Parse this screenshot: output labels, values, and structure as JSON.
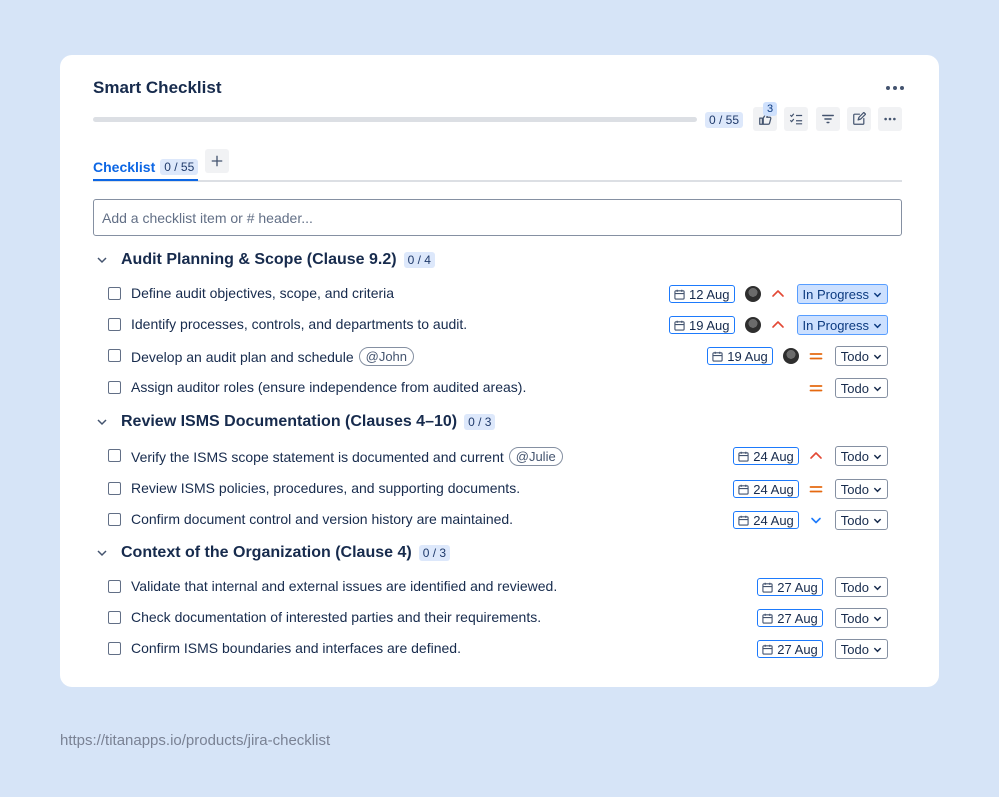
{
  "app": {
    "title": "Smart Checklist"
  },
  "progress": {
    "label": "0 / 55",
    "fraction": 0
  },
  "toolbar": {
    "likes_count": "3"
  },
  "tabs": [
    {
      "label": "Checklist",
      "count": "0 / 55"
    }
  ],
  "add_input": {
    "placeholder": "Add a checklist item or # header..."
  },
  "colors": {
    "accent": "#0c66e4",
    "priority_high": "#e34935",
    "priority_medium": "#e56910",
    "priority_low": "#1d7afc",
    "in_progress": "#cce0ff"
  },
  "sections": [
    {
      "title": "Audit Planning & Scope (Clause 9.2)",
      "count": "0 / 4",
      "items": [
        {
          "text": "Define audit objectives, scope, and criteria",
          "mention": "",
          "date": "12 Aug",
          "avatar": true,
          "priority": "high",
          "status": "In Progress"
        },
        {
          "text": "Identify processes, controls, and departments to audit.",
          "mention": "",
          "date": "19 Aug",
          "avatar": true,
          "priority": "high",
          "status": "In Progress"
        },
        {
          "text": "Develop an audit plan and schedule",
          "mention": "@John",
          "date": "19 Aug",
          "avatar": true,
          "priority": "medium",
          "status": "Todo"
        },
        {
          "text": "Assign auditor roles (ensure independence from audited areas).",
          "mention": "",
          "date": "",
          "avatar": false,
          "priority": "medium",
          "status": "Todo"
        }
      ]
    },
    {
      "title": "Review ISMS Documentation (Clauses 4–10)",
      "count": "0 / 3",
      "items": [
        {
          "text": "Verify the ISMS scope statement is documented and current",
          "mention": "@Julie",
          "date": "24 Aug",
          "avatar": false,
          "priority": "high",
          "status": "Todo"
        },
        {
          "text": "Review ISMS policies, procedures, and supporting documents.",
          "mention": "",
          "date": "24 Aug",
          "avatar": false,
          "priority": "medium",
          "status": "Todo"
        },
        {
          "text": "Confirm document control and version history are maintained.",
          "mention": "",
          "date": "24 Aug",
          "avatar": false,
          "priority": "low",
          "status": "Todo"
        }
      ]
    },
    {
      "title": "Context of the Organization (Clause 4)",
      "count": "0 / 3",
      "items": [
        {
          "text": "Validate that internal and external issues are identified and reviewed.",
          "mention": "",
          "date": "27 Aug",
          "avatar": false,
          "priority": "none",
          "status": "Todo"
        },
        {
          "text": "Check documentation of interested parties and their requirements.",
          "mention": "",
          "date": "27 Aug",
          "avatar": false,
          "priority": "none",
          "status": "Todo"
        },
        {
          "text": "Confirm ISMS boundaries and interfaces are defined.",
          "mention": "",
          "date": "27 Aug",
          "avatar": false,
          "priority": "none",
          "status": "Todo"
        }
      ]
    }
  ],
  "footer": {
    "url": "https://titanapps.io/products/jira-checklist"
  }
}
